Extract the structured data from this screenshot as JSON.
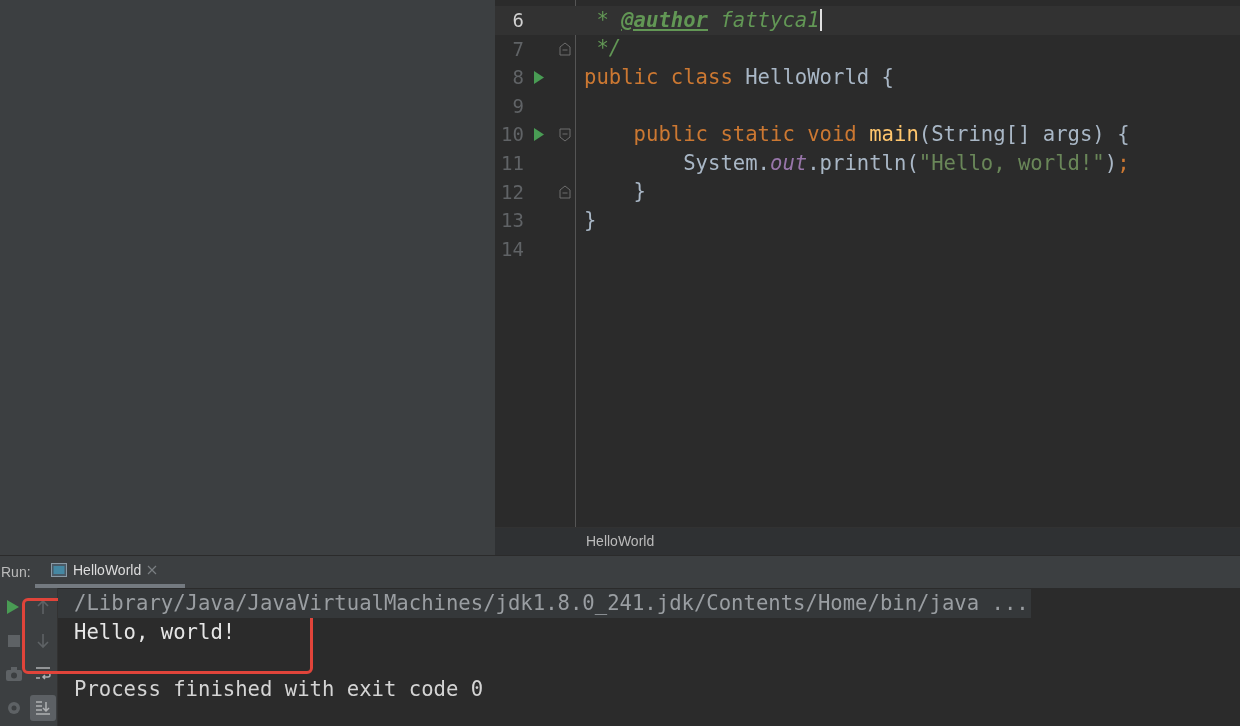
{
  "editor": {
    "lines": [
      {
        "number": "6",
        "current": true,
        "run": false,
        "fold_open": false,
        "fold_close": false,
        "caret": true,
        "tokens": [
          {
            "text": " * ",
            "kind": "comment"
          },
          {
            "text": "@author",
            "kind": "tag"
          },
          {
            "text": " fattyca1",
            "kind": "comment"
          }
        ]
      },
      {
        "number": "7",
        "current": false,
        "run": false,
        "fold_open": false,
        "fold_close": true,
        "caret": false,
        "tokens": [
          {
            "text": " */",
            "kind": "comment"
          }
        ]
      },
      {
        "number": "8",
        "current": false,
        "run": true,
        "fold_open": false,
        "fold_close": false,
        "caret": false,
        "tokens": [
          {
            "text": "public class",
            "kind": "keyword"
          },
          {
            "text": " HelloWorld {",
            "kind": "plain"
          }
        ]
      },
      {
        "number": "9",
        "current": false,
        "run": false,
        "fold_open": false,
        "fold_close": false,
        "caret": false
      },
      {
        "number": "10",
        "current": false,
        "run": true,
        "fold_open": true,
        "fold_close": false,
        "caret": false,
        "tokens": [
          {
            "text": "    public static void",
            "kind": "keyword"
          },
          {
            "text": " main",
            "kind": "method"
          },
          {
            "text": "(String[] args) {",
            "kind": "plain"
          }
        ]
      },
      {
        "number": "11",
        "current": false,
        "run": false,
        "fold_open": false,
        "fold_close": false,
        "caret": false,
        "tokens": [
          {
            "text": "        System.",
            "kind": "plain"
          },
          {
            "text": "out",
            "kind": "field"
          },
          {
            "text": ".println(",
            "kind": "plain"
          },
          {
            "text": "\"Hello, world!\"",
            "kind": "string"
          },
          {
            "text": ")",
            "kind": "plain"
          },
          {
            "text": ";",
            "kind": "keyword"
          }
        ]
      },
      {
        "number": "12",
        "current": false,
        "run": false,
        "fold_open": false,
        "fold_close": true,
        "caret": false,
        "tokens": [
          {
            "text": "    }",
            "kind": "plain"
          }
        ]
      },
      {
        "number": "13",
        "current": false,
        "run": false,
        "fold_open": false,
        "fold_close": false,
        "caret": false,
        "tokens": [
          {
            "text": "}",
            "kind": "plain"
          }
        ]
      },
      {
        "number": "14",
        "current": false,
        "run": false,
        "fold_open": false,
        "fold_close": false,
        "caret": false
      }
    ],
    "breadcrumb": "HelloWorld"
  },
  "run_panel": {
    "label": "Run:",
    "tabs": [
      {
        "label": "HelloWorld",
        "selected": true
      }
    ],
    "tools": [
      {
        "kind": "run",
        "on": false
      },
      {
        "kind": "up",
        "on": false
      },
      {
        "kind": "stop",
        "on": false
      },
      {
        "kind": "down",
        "on": false
      },
      {
        "kind": "camera",
        "on": false
      },
      {
        "kind": "wrap",
        "on": false
      },
      {
        "kind": "bug",
        "on": false
      },
      {
        "kind": "scroll-end",
        "on": true
      }
    ],
    "console": [
      {
        "text": "/Library/Java/JavaVirtualMachines/jdk1.8.0_241.jdk/Contents/Home/bin/java ...",
        "kind": "command"
      },
      {
        "text": "Hello, world!",
        "kind": "output"
      },
      {
        "text": "Process finished with exit code 0",
        "kind": "exit"
      }
    ]
  }
}
